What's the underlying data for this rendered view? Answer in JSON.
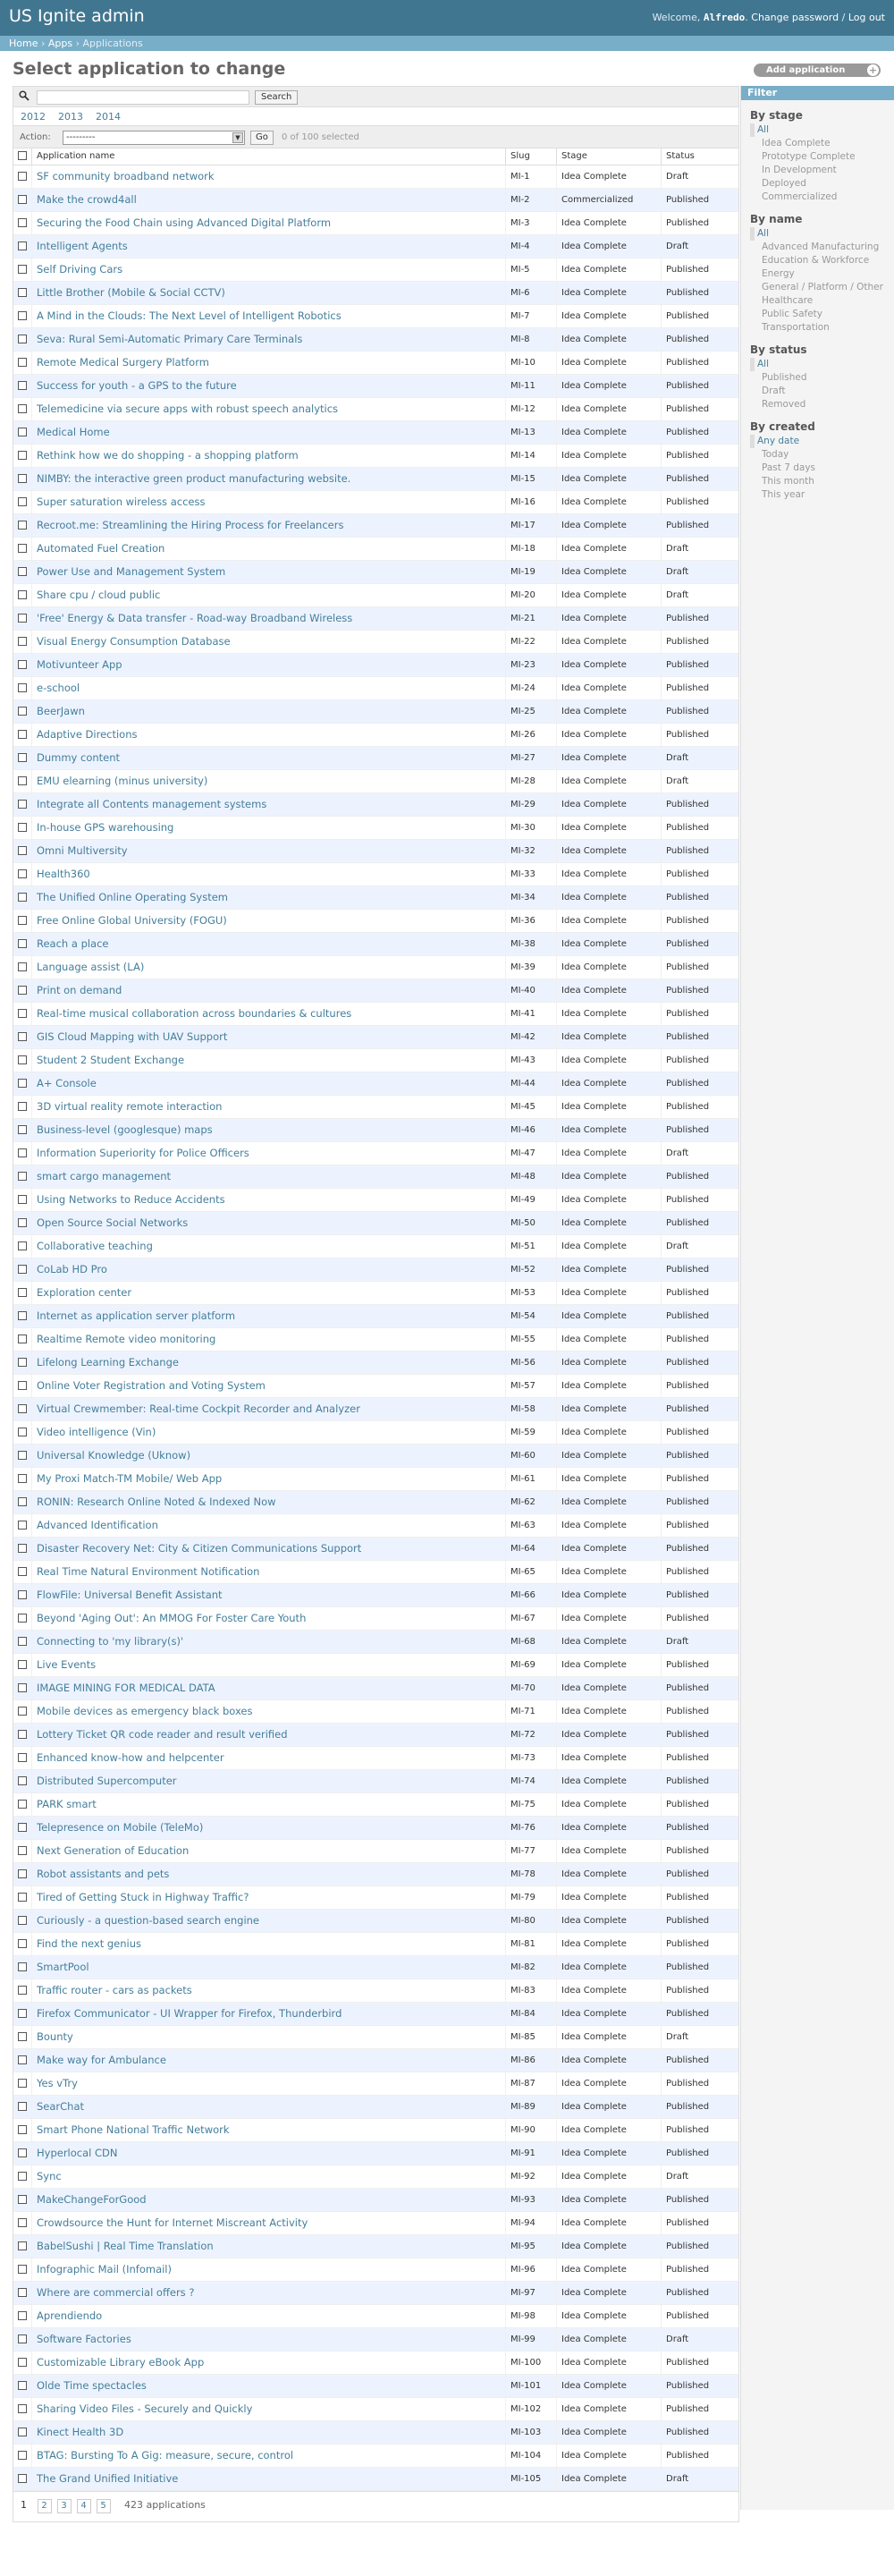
{
  "header": {
    "brand": "US Ignite admin",
    "welcome": "Welcome,",
    "username": "Alfredo",
    "change_password": "Change password",
    "separator": "/",
    "logout": "Log out"
  },
  "breadcrumbs": {
    "home": "Home",
    "apps": "Apps",
    "current": "Applications",
    "sep": "›"
  },
  "page_title": "Select application to change",
  "add_button": "Add application",
  "search": {
    "button": "Search",
    "value": ""
  },
  "years": [
    "2012",
    "2013",
    "2014"
  ],
  "actions": {
    "label": "Action:",
    "selected": "---------",
    "go": "Go",
    "count": "0 of 100 selected"
  },
  "columns": [
    "Application name",
    "Slug",
    "Stage",
    "Status"
  ],
  "rows": [
    [
      "SF community broadband network",
      "MI-1",
      "Idea Complete",
      "Draft"
    ],
    [
      "Make the crowd4all",
      "MI-2",
      "Commercialized",
      "Published"
    ],
    [
      "Securing the Food Chain using Advanced Digital Platform",
      "MI-3",
      "Idea Complete",
      "Published"
    ],
    [
      "Intelligent Agents",
      "MI-4",
      "Idea Complete",
      "Draft"
    ],
    [
      "Self Driving Cars",
      "MI-5",
      "Idea Complete",
      "Published"
    ],
    [
      "Little Brother (Mobile & Social CCTV)",
      "MI-6",
      "Idea Complete",
      "Published"
    ],
    [
      "A Mind in the Clouds: The Next Level of Intelligent Robotics",
      "MI-7",
      "Idea Complete",
      "Published"
    ],
    [
      "Seva: Rural Semi-Automatic Primary Care Terminals",
      "MI-8",
      "Idea Complete",
      "Published"
    ],
    [
      "Remote Medical Surgery Platform",
      "MI-10",
      "Idea Complete",
      "Published"
    ],
    [
      "Success for youth - a GPS to the future",
      "MI-11",
      "Idea Complete",
      "Published"
    ],
    [
      "Telemedicine via secure apps with robust speech analytics",
      "MI-12",
      "Idea Complete",
      "Published"
    ],
    [
      "Medical Home",
      "MI-13",
      "Idea Complete",
      "Published"
    ],
    [
      "Rethink how we do shopping - a shopping platform",
      "MI-14",
      "Idea Complete",
      "Published"
    ],
    [
      "NIMBY: the interactive green product manufacturing website.",
      "MI-15",
      "Idea Complete",
      "Published"
    ],
    [
      "Super saturation wireless access",
      "MI-16",
      "Idea Complete",
      "Published"
    ],
    [
      "Recroot.me: Streamlining the Hiring Process for Freelancers",
      "MI-17",
      "Idea Complete",
      "Published"
    ],
    [
      "Automated Fuel Creation",
      "MI-18",
      "Idea Complete",
      "Draft"
    ],
    [
      "Power Use and Management System",
      "MI-19",
      "Idea Complete",
      "Draft"
    ],
    [
      "Share cpu / cloud public",
      "MI-20",
      "Idea Complete",
      "Draft"
    ],
    [
      "'Free' Energy & Data transfer - Road-way Broadband Wireless",
      "MI-21",
      "Idea Complete",
      "Published"
    ],
    [
      "Visual Energy Consumption Database",
      "MI-22",
      "Idea Complete",
      "Published"
    ],
    [
      "Motivunteer App",
      "MI-23",
      "Idea Complete",
      "Published"
    ],
    [
      "e-school",
      "MI-24",
      "Idea Complete",
      "Published"
    ],
    [
      "BeerJawn",
      "MI-25",
      "Idea Complete",
      "Published"
    ],
    [
      "Adaptive Directions",
      "MI-26",
      "Idea Complete",
      "Published"
    ],
    [
      "Dummy content",
      "MI-27",
      "Idea Complete",
      "Draft"
    ],
    [
      "EMU elearning (minus university)",
      "MI-28",
      "Idea Complete",
      "Draft"
    ],
    [
      "Integrate all Contents management systems",
      "MI-29",
      "Idea Complete",
      "Published"
    ],
    [
      "In-house GPS warehousing",
      "MI-30",
      "Idea Complete",
      "Published"
    ],
    [
      "Omni Multiversity",
      "MI-32",
      "Idea Complete",
      "Published"
    ],
    [
      "Health360",
      "MI-33",
      "Idea Complete",
      "Published"
    ],
    [
      "The Unified Online Operating System",
      "MI-34",
      "Idea Complete",
      "Published"
    ],
    [
      "Free Online Global University (FOGU)",
      "MI-36",
      "Idea Complete",
      "Published"
    ],
    [
      "Reach a place",
      "MI-38",
      "Idea Complete",
      "Published"
    ],
    [
      "Language assist (LA)",
      "MI-39",
      "Idea Complete",
      "Published"
    ],
    [
      "Print on demand",
      "MI-40",
      "Idea Complete",
      "Published"
    ],
    [
      "Real-time musical collaboration across boundaries & cultures",
      "MI-41",
      "Idea Complete",
      "Published"
    ],
    [
      "GIS Cloud Mapping with UAV Support",
      "MI-42",
      "Idea Complete",
      "Published"
    ],
    [
      "Student 2 Student Exchange",
      "MI-43",
      "Idea Complete",
      "Published"
    ],
    [
      "A+ Console",
      "MI-44",
      "Idea Complete",
      "Published"
    ],
    [
      "3D virtual reality remote interaction",
      "MI-45",
      "Idea Complete",
      "Published"
    ],
    [
      "Business-level (googlesque) maps",
      "MI-46",
      "Idea Complete",
      "Published"
    ],
    [
      "Information Superiority for Police Officers",
      "MI-47",
      "Idea Complete",
      "Draft"
    ],
    [
      "smart cargo management",
      "MI-48",
      "Idea Complete",
      "Published"
    ],
    [
      "Using Networks to Reduce Accidents",
      "MI-49",
      "Idea Complete",
      "Published"
    ],
    [
      "Open Source Social Networks",
      "MI-50",
      "Idea Complete",
      "Published"
    ],
    [
      "Collaborative teaching",
      "MI-51",
      "Idea Complete",
      "Draft"
    ],
    [
      "CoLab HD Pro",
      "MI-52",
      "Idea Complete",
      "Published"
    ],
    [
      "Exploration center",
      "MI-53",
      "Idea Complete",
      "Published"
    ],
    [
      "Internet as application server platform",
      "MI-54",
      "Idea Complete",
      "Published"
    ],
    [
      "Realtime Remote video monitoring",
      "MI-55",
      "Idea Complete",
      "Published"
    ],
    [
      "Lifelong Learning Exchange",
      "MI-56",
      "Idea Complete",
      "Published"
    ],
    [
      "Online Voter Registration and Voting System",
      "MI-57",
      "Idea Complete",
      "Published"
    ],
    [
      "Virtual Crewmember: Real-time Cockpit Recorder and Analyzer",
      "MI-58",
      "Idea Complete",
      "Published"
    ],
    [
      "Video intelligence (Vin)",
      "MI-59",
      "Idea Complete",
      "Published"
    ],
    [
      "Universal Knowledge (Uknow)",
      "MI-60",
      "Idea Complete",
      "Published"
    ],
    [
      "My Proxi Match-TM Mobile/ Web App",
      "MI-61",
      "Idea Complete",
      "Published"
    ],
    [
      "RONIN: Research Online Noted & Indexed Now",
      "MI-62",
      "Idea Complete",
      "Published"
    ],
    [
      "Advanced Identification",
      "MI-63",
      "Idea Complete",
      "Published"
    ],
    [
      "Disaster Recovery Net: City & Citizen Communications Support",
      "MI-64",
      "Idea Complete",
      "Published"
    ],
    [
      "Real Time Natural Environment Notification",
      "MI-65",
      "Idea Complete",
      "Published"
    ],
    [
      "FlowFile: Universal Benefit Assistant",
      "MI-66",
      "Idea Complete",
      "Published"
    ],
    [
      "Beyond 'Aging Out': An MMOG For Foster Care Youth",
      "MI-67",
      "Idea Complete",
      "Published"
    ],
    [
      "Connecting to 'my library(s)'",
      "MI-68",
      "Idea Complete",
      "Draft"
    ],
    [
      "Live Events",
      "MI-69",
      "Idea Complete",
      "Published"
    ],
    [
      "IMAGE MINING FOR MEDICAL DATA",
      "MI-70",
      "Idea Complete",
      "Published"
    ],
    [
      "Mobile devices as emergency black boxes",
      "MI-71",
      "Idea Complete",
      "Published"
    ],
    [
      "Lottery Ticket QR code reader and result verified",
      "MI-72",
      "Idea Complete",
      "Published"
    ],
    [
      "Enhanced know-how and helpcenter",
      "MI-73",
      "Idea Complete",
      "Published"
    ],
    [
      "Distributed Supercomputer",
      "MI-74",
      "Idea Complete",
      "Published"
    ],
    [
      "PARK smart",
      "MI-75",
      "Idea Complete",
      "Published"
    ],
    [
      "Telepresence on Mobile (TeleMo)",
      "MI-76",
      "Idea Complete",
      "Published"
    ],
    [
      "Next Generation of Education",
      "MI-77",
      "Idea Complete",
      "Published"
    ],
    [
      "Robot assistants and pets",
      "MI-78",
      "Idea Complete",
      "Published"
    ],
    [
      "Tired of Getting Stuck in Highway Traffic?",
      "MI-79",
      "Idea Complete",
      "Published"
    ],
    [
      "Curiously - a question-based search engine",
      "MI-80",
      "Idea Complete",
      "Published"
    ],
    [
      "Find the next genius",
      "MI-81",
      "Idea Complete",
      "Published"
    ],
    [
      "SmartPool",
      "MI-82",
      "Idea Complete",
      "Published"
    ],
    [
      "Traffic router - cars as packets",
      "MI-83",
      "Idea Complete",
      "Published"
    ],
    [
      "Firefox Communicator - UI Wrapper for Firefox, Thunderbird",
      "MI-84",
      "Idea Complete",
      "Published"
    ],
    [
      "Bounty",
      "MI-85",
      "Idea Complete",
      "Draft"
    ],
    [
      "Make way for Ambulance",
      "MI-86",
      "Idea Complete",
      "Published"
    ],
    [
      "Yes vTry",
      "MI-87",
      "Idea Complete",
      "Published"
    ],
    [
      "SearChat",
      "MI-89",
      "Idea Complete",
      "Published"
    ],
    [
      "Smart Phone National Traffic Network",
      "MI-90",
      "Idea Complete",
      "Published"
    ],
    [
      "Hyperlocal CDN",
      "MI-91",
      "Idea Complete",
      "Published"
    ],
    [
      "Sync",
      "MI-92",
      "Idea Complete",
      "Draft"
    ],
    [
      "MakeChangeForGood",
      "MI-93",
      "Idea Complete",
      "Published"
    ],
    [
      "Crowdsource the Hunt for Internet Miscreant Activity",
      "MI-94",
      "Idea Complete",
      "Published"
    ],
    [
      "BabelSushi | Real Time Translation",
      "MI-95",
      "Idea Complete",
      "Published"
    ],
    [
      "Infographic Mail (Infomail)",
      "MI-96",
      "Idea Complete",
      "Published"
    ],
    [
      "Where are commercial offers ?",
      "MI-97",
      "Idea Complete",
      "Published"
    ],
    [
      "Aprendiendo",
      "MI-98",
      "Idea Complete",
      "Published"
    ],
    [
      "Software Factories",
      "MI-99",
      "Idea Complete",
      "Draft"
    ],
    [
      "Customizable Library eBook App",
      "MI-100",
      "Idea Complete",
      "Published"
    ],
    [
      "Olde Time spectacles",
      "MI-101",
      "Idea Complete",
      "Published"
    ],
    [
      "Sharing Video Files - Securely and Quickly",
      "MI-102",
      "Idea Complete",
      "Published"
    ],
    [
      "Kinect Health 3D",
      "MI-103",
      "Idea Complete",
      "Published"
    ],
    [
      "BTAG: Bursting To A Gig: measure, secure, control",
      "MI-104",
      "Idea Complete",
      "Published"
    ],
    [
      "The Grand Unified Initiative",
      "MI-105",
      "Idea Complete",
      "Draft"
    ]
  ],
  "paginator": {
    "current": "1",
    "pages": [
      "2",
      "3",
      "4",
      "5"
    ],
    "total": "423 applications"
  },
  "filter": {
    "title": "Filter",
    "groups": [
      {
        "title": "By stage",
        "items": [
          "All",
          "Idea Complete",
          "Prototype Complete",
          "In Development",
          "Deployed",
          "Commercialized"
        ]
      },
      {
        "title": "By name",
        "items": [
          "All",
          "Advanced Manufacturing",
          "Education & Workforce",
          "Energy",
          "General / Platform / Other",
          "Healthcare",
          "Public Safety",
          "Transportation"
        ]
      },
      {
        "title": "By status",
        "items": [
          "All",
          "Published",
          "Draft",
          "Removed"
        ]
      },
      {
        "title": "By created",
        "items": [
          "Any date",
          "Today",
          "Past 7 days",
          "This month",
          "This year"
        ]
      }
    ]
  }
}
